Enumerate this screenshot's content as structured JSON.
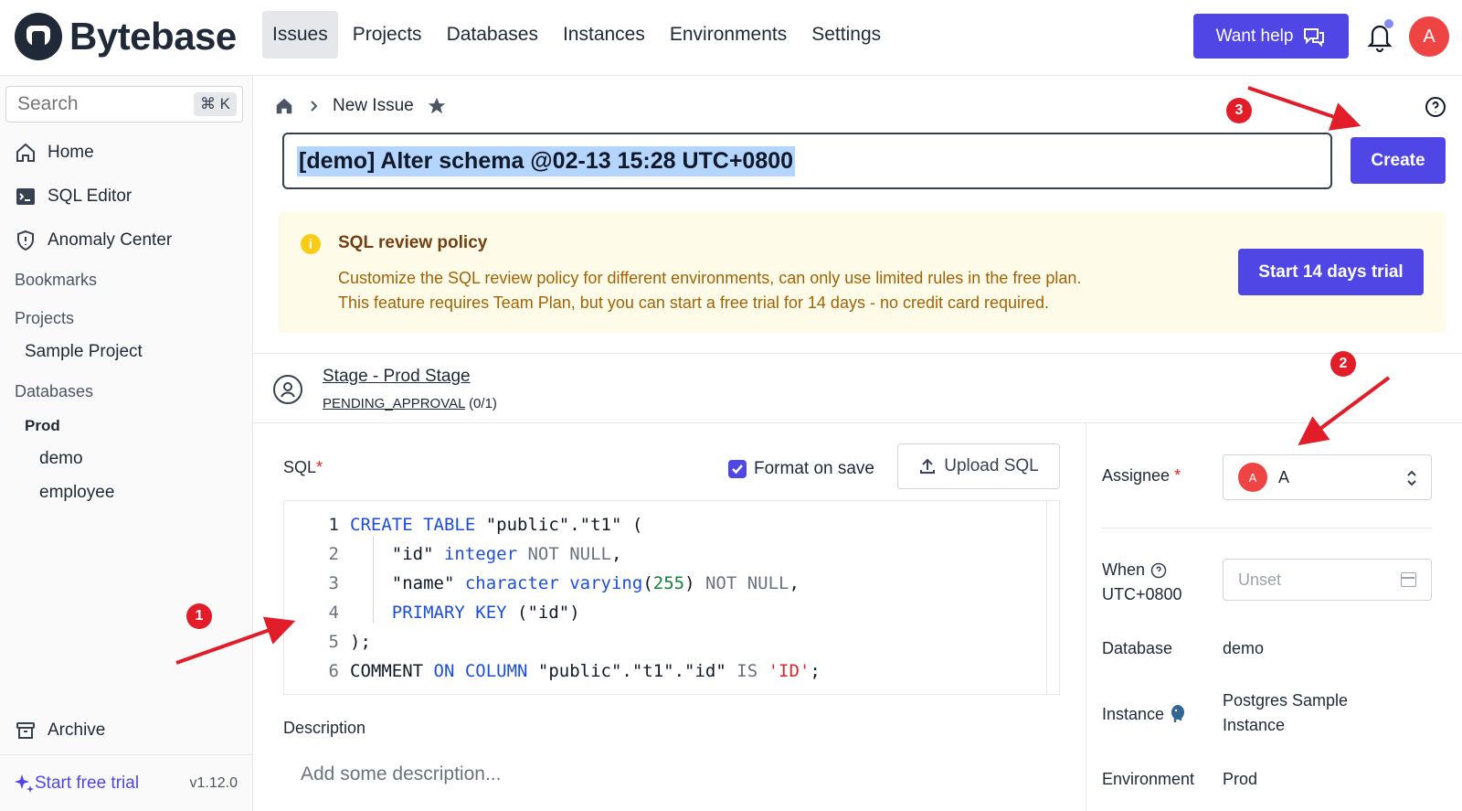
{
  "brand": {
    "name": "Bytebase"
  },
  "nav": {
    "items": [
      {
        "label": "Issues",
        "active": true
      },
      {
        "label": "Projects"
      },
      {
        "label": "Databases"
      },
      {
        "label": "Instances"
      },
      {
        "label": "Environments"
      },
      {
        "label": "Settings"
      }
    ],
    "help_label": "Want help",
    "avatar_initial": "A"
  },
  "sidebar": {
    "search_placeholder": "Search",
    "search_shortcut": "⌘ K",
    "items": [
      {
        "label": "Home",
        "icon": "home-icon"
      },
      {
        "label": "SQL Editor",
        "icon": "terminal-icon"
      },
      {
        "label": "Anomaly Center",
        "icon": "shield-icon"
      }
    ],
    "bookmarks_heading": "Bookmarks",
    "projects_heading": "Projects",
    "projects": [
      "Sample Project"
    ],
    "databases_heading": "Databases",
    "database_env": "Prod",
    "databases": [
      "demo",
      "employee"
    ],
    "archive_label": "Archive",
    "trial_label": "Start free trial",
    "version": "v1.12.0"
  },
  "breadcrumb": {
    "current": "New Issue"
  },
  "issue": {
    "title": "[demo] Alter schema @02-13 15:28 UTC+0800",
    "create_label": "Create"
  },
  "banner": {
    "title": "SQL review policy",
    "line1": "Customize the SQL review policy for different environments, can only use limited rules in the free plan.",
    "line2": "This feature requires Team Plan, but you can start a free trial for 14 days - no credit card required.",
    "button_label": "Start 14 days trial"
  },
  "stage": {
    "title": "Stage - Prod Stage",
    "status": "PENDING_APPROVAL",
    "progress": "(0/1)"
  },
  "sql": {
    "label": "SQL",
    "required_mark": "*",
    "format_on_save_label": "Format on save",
    "format_on_save_checked": true,
    "upload_label": "Upload SQL",
    "lines": [
      {
        "n": "1",
        "tokens": [
          [
            "kw",
            "CREATE TABLE"
          ],
          [
            "stmt",
            " \"public\".\"t1\" ("
          ]
        ]
      },
      {
        "n": "2",
        "tokens": [
          [
            "stmt",
            "    \"id\" "
          ],
          [
            "kw",
            "integer"
          ],
          [
            "gr",
            " NOT NULL"
          ],
          [
            "stmt",
            ","
          ]
        ]
      },
      {
        "n": "3",
        "tokens": [
          [
            "stmt",
            "    \"name\" "
          ],
          [
            "kw",
            "character varying"
          ],
          [
            "stmt",
            "("
          ],
          [
            "nm",
            "255"
          ],
          [
            "stmt",
            ") "
          ],
          [
            "gr",
            "NOT NULL"
          ],
          [
            "stmt",
            ","
          ]
        ]
      },
      {
        "n": "4",
        "tokens": [
          [
            "stmt",
            "    "
          ],
          [
            "kw",
            "PRIMARY KEY"
          ],
          [
            "stmt",
            " (\"id\")"
          ]
        ]
      },
      {
        "n": "5",
        "tokens": [
          [
            "stmt",
            ");"
          ]
        ]
      },
      {
        "n": "6",
        "tokens": [
          [
            "stmt",
            "COMMENT "
          ],
          [
            "kw",
            "ON COLUMN"
          ],
          [
            "stmt",
            " \"public\".\"t1\".\"id\" "
          ],
          [
            "gr",
            "IS"
          ],
          [
            "stmt",
            " "
          ],
          [
            "strred",
            "'ID'"
          ],
          [
            "stmt",
            ";"
          ]
        ]
      }
    ]
  },
  "description": {
    "label": "Description",
    "placeholder": "Add some description..."
  },
  "side_panel": {
    "assignee_label": "Assignee",
    "assignee_required": "*",
    "assignee_initial": "A",
    "assignee_name": "A",
    "when_label": "When",
    "when_tz": "UTC+0800",
    "when_placeholder": "Unset",
    "database_label": "Database",
    "database_value": "demo",
    "instance_label": "Instance",
    "instance_value_1": "Postgres Sample",
    "instance_value_2": "Instance",
    "environment_label": "Environment",
    "environment_value": "Prod"
  },
  "annotations": {
    "m1": "1",
    "m2": "2",
    "m3": "3"
  },
  "colors": {
    "accent": "#4f46e5",
    "annotation": "#e11d2a",
    "banner_bg": "#fefce8"
  }
}
